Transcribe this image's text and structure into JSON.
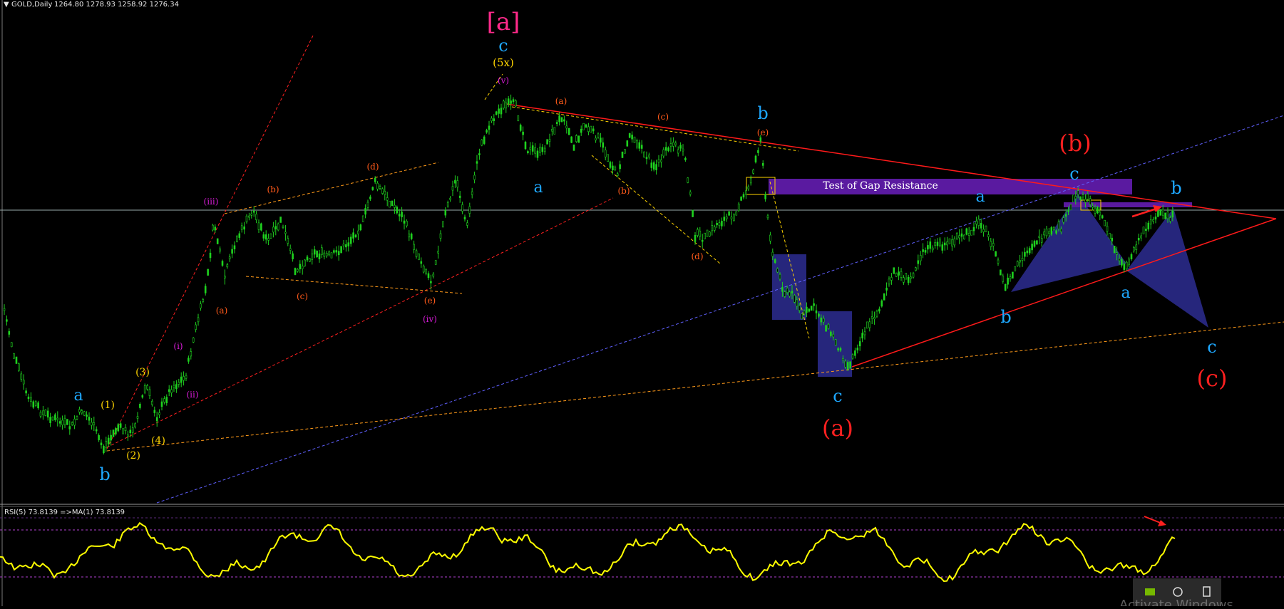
{
  "chart_header": {
    "arrow": "▼",
    "title": "GOLD,Daily",
    "ohlc": "1264.80 1278.93 1258.92 1276.34"
  },
  "rsi_header": "RSI(5) 73.8139  =>MA(1) 73.8139",
  "annotation_box": "Test of Gap Resistance",
  "colors": {
    "background": "#000000",
    "candle": "#1fd21f",
    "rsi_line": "#ffff00",
    "trendline_red": "#ff1a1a",
    "box_purple": "#5a1aa0",
    "box_blue": "#2a2a8a",
    "wave_cyan": "#1ea8ff",
    "wave_red": "#ff2020",
    "wave_yellow": "#ffd400",
    "wave_magenta": "#d81bd8",
    "wave_orange": "#ff5a1a",
    "bracket_pink": "#ff2a8a"
  },
  "wave_labels": {
    "top_bracket": "[a]",
    "top_c": "c",
    "top_5x": "(5x)",
    "top_v": "(v)",
    "b_top": "b",
    "a_blue_1": "a",
    "a_blue_2": "a",
    "a_blue_3": "a",
    "a_blue_4": "a",
    "b_blue_1": "b",
    "b_blue_2": "b",
    "b_blue_3": "b",
    "c_blue_1": "c",
    "c_blue_2": "c",
    "c_blue_3": "c",
    "big_a": "(a)",
    "big_b": "(b)",
    "big_c": "(c)",
    "iii": "(iii)",
    "iv": "(iv)",
    "ii": "(ii)",
    "i": "(i)",
    "y1": "(1)",
    "y2": "(2)",
    "y3": "(3)",
    "y4": "(4)",
    "o_a1": "(a)",
    "o_b1": "(b)",
    "o_c1": "(c)",
    "o_d1": "(d)",
    "o_e1": "(e)",
    "o_a2": "(a)",
    "o_b2": "(b)",
    "o_c2": "(c)",
    "o_d2": "(d)",
    "o_e2": "(e)"
  },
  "chart_data": {
    "type": "line",
    "symbol": "GOLD",
    "timeframe": "Daily",
    "open": 1264.8,
    "high": 1278.93,
    "low": 1258.92,
    "close": 1276.34,
    "rsi_period": 5,
    "rsi_value": 73.8139,
    "ma_period": 1,
    "ma_value": 73.8139,
    "series": []
  },
  "taskbar": {
    "icons": [
      "nvidia-icon",
      "network-icon",
      "usb-icon"
    ],
    "watermark": "Activate Windows"
  }
}
